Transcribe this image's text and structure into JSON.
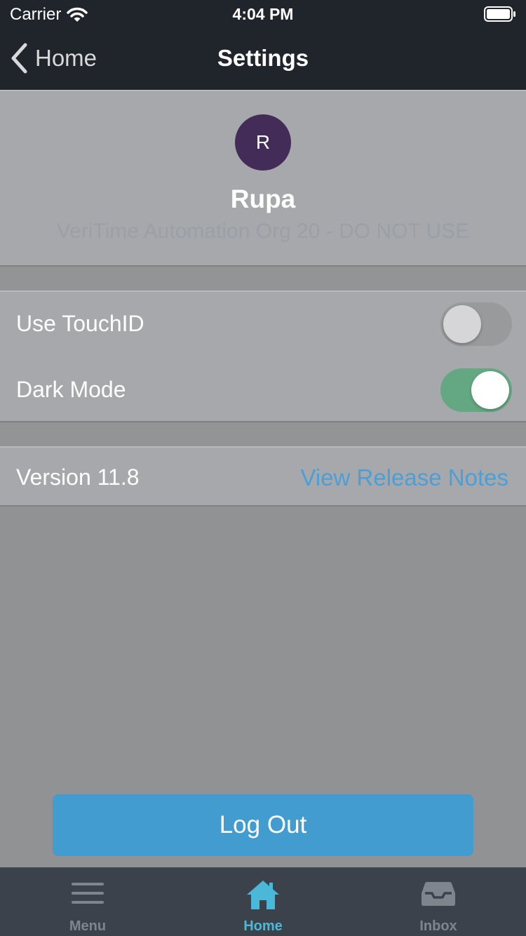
{
  "status_bar": {
    "carrier": "Carrier",
    "time": "4:04 PM"
  },
  "nav": {
    "back_label": "Home",
    "title": "Settings"
  },
  "profile": {
    "avatar_initial": "R",
    "name": "Rupa",
    "org": "VeriTime Automation Org 20 - DO NOT USE"
  },
  "settings": {
    "touch_id": {
      "label": "Use TouchID",
      "enabled": false
    },
    "dark_mode": {
      "label": "Dark Mode",
      "enabled": true
    }
  },
  "about": {
    "version": "Version 11.8",
    "release_notes_link": "View Release Notes"
  },
  "logout_label": "Log Out",
  "tabs": [
    {
      "label": "Menu",
      "icon": "menu-icon",
      "active": false
    },
    {
      "label": "Home",
      "icon": "home-icon",
      "active": true
    },
    {
      "label": "Inbox",
      "icon": "inbox-icon",
      "active": false
    }
  ],
  "colors": {
    "header_bg": "#20242b",
    "accent": "#429ccf",
    "link": "#4b9fd8",
    "active_tab": "#4bb8d8",
    "inactive_tab": "#7e858d",
    "toggle_on": "#64a883",
    "toggle_off": "#999a9c",
    "avatar_bg": "#432c58"
  }
}
